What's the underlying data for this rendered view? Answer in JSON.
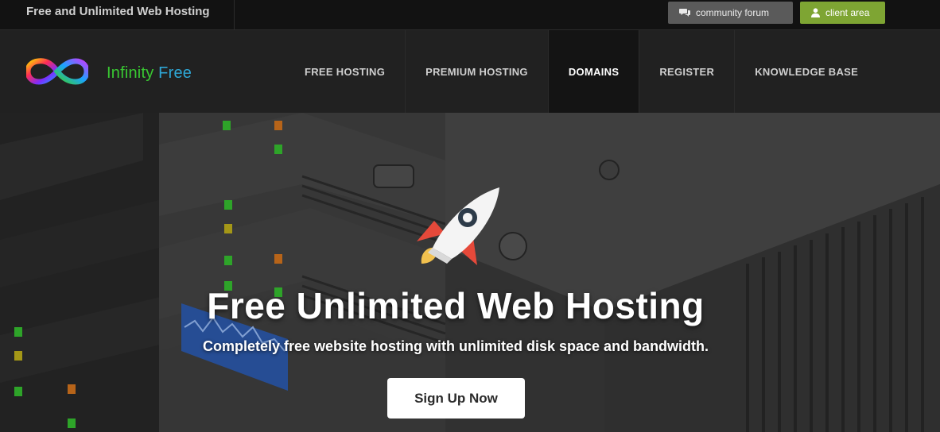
{
  "topbar": {
    "tagline": "Free and Unlimited Web Hosting",
    "forum_label": "community forum",
    "forum_icon": "comments-icon",
    "client_label": "client area",
    "client_icon": "user-icon",
    "client_color": "#7ea533"
  },
  "brand": {
    "word1": "Infinity",
    "word2": "Free",
    "color1": "#39c832",
    "color2": "#2ea7d6"
  },
  "nav": {
    "items": [
      {
        "label": "FREE HOSTING"
      },
      {
        "label": "PREMIUM HOSTING"
      },
      {
        "label": "DOMAINS"
      },
      {
        "label": "REGISTER"
      },
      {
        "label": "KNOWLEDGE BASE"
      }
    ],
    "active": "DOMAINS"
  },
  "hero": {
    "title": "Free Unlimited Web Hosting",
    "subtitle": "Completely free website hosting with unlimited disk space and bandwidth.",
    "cta_label": "Sign Up Now",
    "illustration": "rocket-icon"
  }
}
